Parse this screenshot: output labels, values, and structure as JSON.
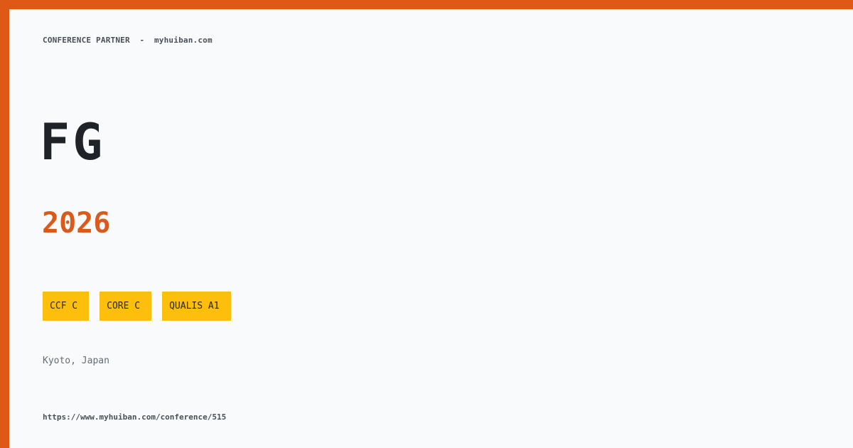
{
  "header": {
    "partner_label": "CONFERENCE PARTNER",
    "separator": "-",
    "site": "myhuiban.com"
  },
  "conference": {
    "acronym": "FG",
    "year": "2026",
    "location": "Kyoto, Japan",
    "url": "https://www.myhuiban.com/conference/515"
  },
  "badges": [
    {
      "label": "CCF C"
    },
    {
      "label": "CORE C"
    },
    {
      "label": "QUALIS A1"
    }
  ],
  "colors": {
    "accent": "#DF5815",
    "badge": "#FEBF0C",
    "background": "#F8FAFB",
    "year": "#D95A1A"
  }
}
